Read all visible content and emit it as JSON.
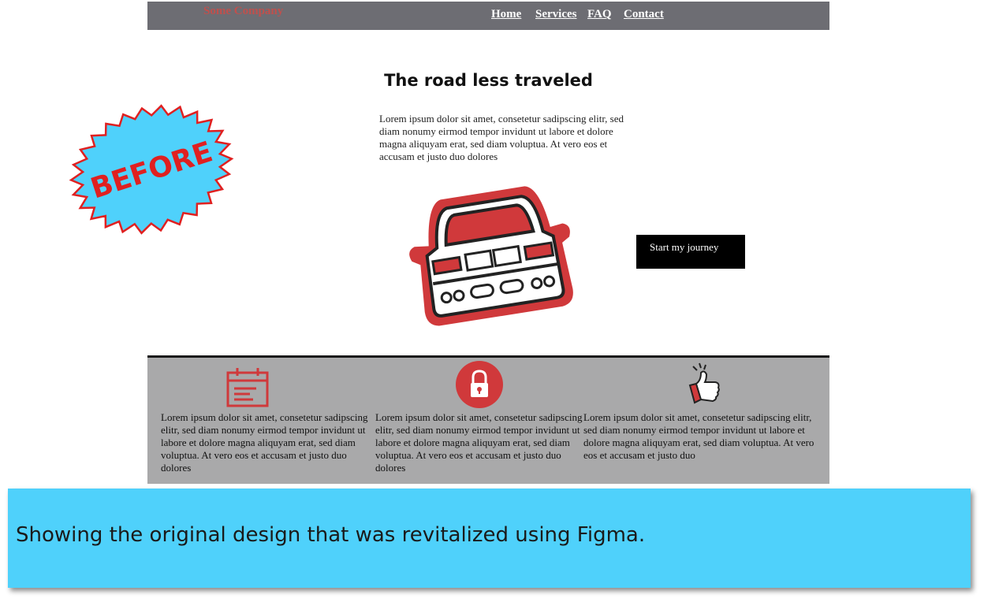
{
  "site": {
    "brand": "Some Company",
    "nav": [
      "Home",
      "Services",
      "FAQ",
      "Contact"
    ],
    "hero_title": "The road less traveled",
    "hero_text": "Lorem ipsum dolor sit amet, consetetur sadipscing elitr, sed diam nonumy eirmod tempor invidunt ut labore et dolore magna aliquyam erat, sed diam voluptua. At vero eos et accusam et justo duo dolores",
    "cta_label": "Start my journey",
    "features": [
      {
        "icon": "calendar-icon",
        "text": "Lorem ipsum dolor sit amet, consetetur sadipscing elitr, sed diam nonumy eirmod tempor invidunt ut labore et dolore magna aliquyam erat, sed diam voluptua. At vero eos et accusam et justo duo dolores"
      },
      {
        "icon": "lock-icon",
        "text": "Lorem ipsum dolor sit amet, consetetur sadipscing elitr, sed diam nonumy eirmod tempor invidunt ut labore et dolore magna aliquyam erat, sed diam voluptua. At vero eos et accusam et justo duo dolores"
      },
      {
        "icon": "thumbs-up-icon",
        "text": "Lorem ipsum dolor sit amet, consetetur sadipscing elitr, sed diam nonumy eirmod tempor invidunt ut labore et dolore magna aliquyam erat, sed diam voluptua. At vero eos et accusam et justo duo"
      }
    ]
  },
  "badge": {
    "label": "BEFORE",
    "fill": "#4fd1fb",
    "stroke": "#e02020",
    "text_color": "#e02020"
  },
  "caption": {
    "text": "Showing the original design that was revitalized using Figma."
  },
  "colors": {
    "accent_red": "#d0393b",
    "nav_bg": "#6d6d73",
    "features_bg": "#a9a9aa",
    "caption_bg": "#4fd1fb"
  }
}
